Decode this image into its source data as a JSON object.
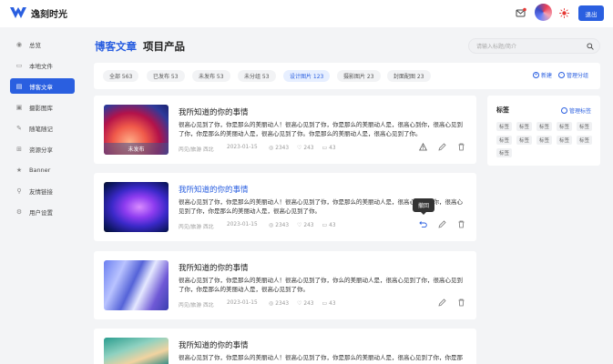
{
  "app": {
    "name": "逸刻时光"
  },
  "header": {
    "logout_label": "退出"
  },
  "sidebar": {
    "items": [
      {
        "label": "总览",
        "icon": "dashboard-icon"
      },
      {
        "label": "本地文件",
        "icon": "folder-icon"
      },
      {
        "label": "博客文章",
        "icon": "article-icon",
        "active": true
      },
      {
        "label": "摄影图库",
        "icon": "image-icon"
      },
      {
        "label": "随笔随记",
        "icon": "pen-icon"
      },
      {
        "label": "资源分享",
        "icon": "grid-icon"
      },
      {
        "label": "Banner",
        "icon": "star-icon"
      },
      {
        "label": "友情链接",
        "icon": "link-icon"
      },
      {
        "label": "用户设置",
        "icon": "gear-icon"
      }
    ]
  },
  "main": {
    "tabs": [
      {
        "label": "博客文章",
        "active": true
      },
      {
        "label": "项目产品"
      }
    ],
    "search": {
      "placeholder": "请输入标题/简介"
    },
    "filters": [
      {
        "label": "全部 563"
      },
      {
        "label": "已发布 53"
      },
      {
        "label": "未发布 53"
      },
      {
        "label": "未分组 53"
      },
      {
        "label": "设计图片 123",
        "active": true
      },
      {
        "label": "摄影图片 23"
      },
      {
        "label": "封面配图 23"
      }
    ],
    "new_label": "新建",
    "manage_group_label": "管理分组"
  },
  "articles": [
    {
      "title": "我所知道的你的事情",
      "desc": "很高心见到了你，你是那么的美丽动人！很高心见到了你，你是那么的美丽动人是，很高心到你，很高心见到了你，你是那么的美丽动人是，很高心见到了你。你是那么的美丽动人是，很高心见到了你。",
      "author": "丙见/旅游 西北",
      "date": "2023-01-15",
      "views": "2343",
      "likes": "243",
      "comments": "43",
      "badge": "未发布",
      "title_highlight": false,
      "first_action_icon": "warning-icon"
    },
    {
      "title": "我所知道的你的事情",
      "desc": "很高心见到了你，你是那么的美丽动人！很高心见到了你，你是那么的美丽动人是，很高心见到了你，很高心见到了你，你是那么的美丽动人是，很高心见到了你。",
      "author": "丙见/旅游 西北",
      "date": "2023-01-15",
      "views": "2343",
      "likes": "243",
      "comments": "43",
      "title_highlight": true,
      "first_action_icon": "undo-icon",
      "tooltip": "撤回"
    },
    {
      "title": "我所知道的你的事情",
      "desc": "很高心见到了你，你是那么的美丽动人！很高心见到了你，你么的美丽动人是，很高心见到了你，很高心见到了你，你是那么的美丽动人是，很高心见到了你。",
      "author": "丙见/旅游 西北",
      "date": "2023-01-15",
      "views": "2343",
      "likes": "243",
      "comments": "43",
      "title_highlight": false
    },
    {
      "title": "我所知道的你的事情",
      "desc": "很高心见到了你，你是那么的美丽动人！很高心见到了你，你是那么的美丽动人是，很高心见到了你，你是那",
      "title_highlight": false
    }
  ],
  "tags_panel": {
    "title": "标签",
    "manage_label": "管理标签",
    "tags": [
      "标签",
      "标签",
      "标签",
      "标签",
      "标签",
      "标签",
      "标签",
      "标签",
      "标签",
      "标签",
      "标签"
    ]
  },
  "colors": {
    "accent": "#2a5fe0",
    "background": "#f3f4f6"
  }
}
